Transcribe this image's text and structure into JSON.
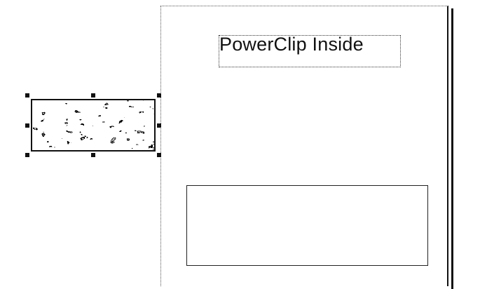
{
  "document": {
    "text_object": "PowerClip Inside"
  },
  "icons": {
    "selection_handle": "selection-handle-square",
    "bitmap_texture": "crumpled-foil-texture"
  },
  "colors": {
    "ink": "#111111",
    "background": "#ffffff"
  }
}
